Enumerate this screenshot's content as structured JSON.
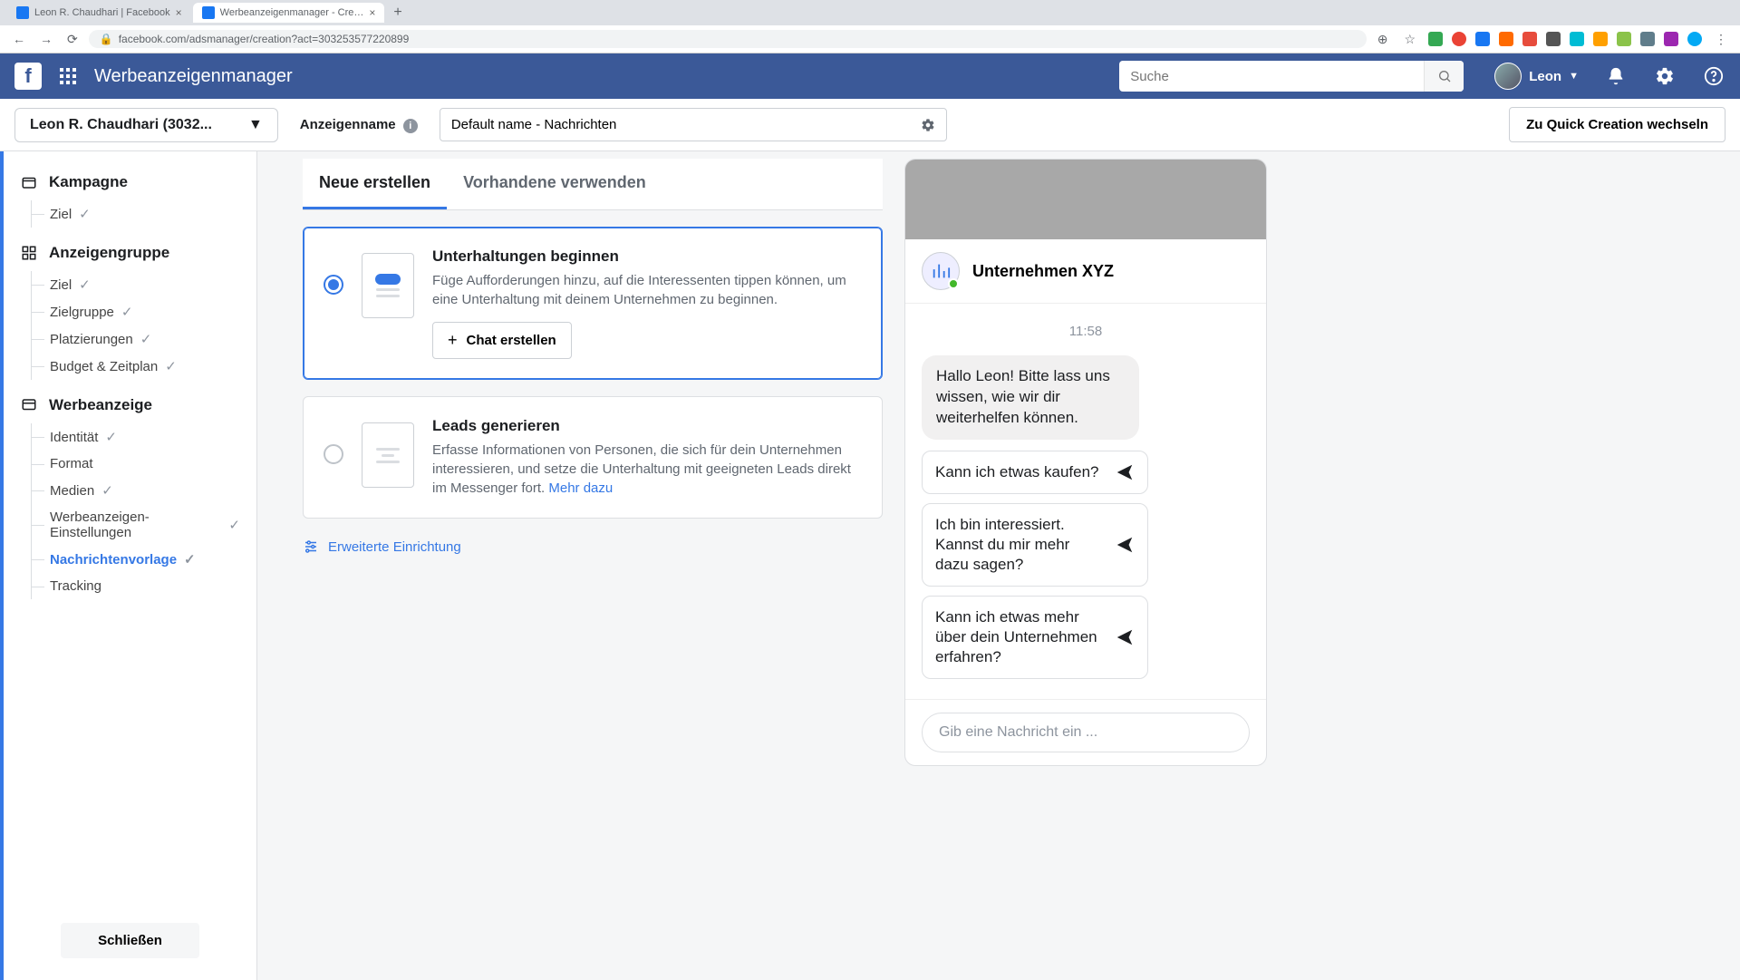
{
  "browser": {
    "tabs": [
      {
        "title": "Leon R. Chaudhari | Facebook",
        "active": false
      },
      {
        "title": "Werbeanzeigenmanager - Cre…",
        "active": true
      }
    ],
    "url": "facebook.com/adsmanager/creation?act=303253577220899"
  },
  "appbar": {
    "title": "Werbeanzeigenmanager",
    "search_placeholder": "Suche",
    "user_name": "Leon"
  },
  "secondbar": {
    "account": "Leon R. Chaudhari (3032...",
    "name_label": "Anzeigenname",
    "name_value": "Default name - Nachrichten",
    "quick_creation": "Zu Quick Creation wechseln"
  },
  "sidebar": {
    "groups": [
      {
        "title": "Kampagne",
        "items": [
          {
            "label": "Ziel",
            "checked": true
          }
        ]
      },
      {
        "title": "Anzeigengruppe",
        "items": [
          {
            "label": "Ziel",
            "checked": true
          },
          {
            "label": "Zielgruppe",
            "checked": true
          },
          {
            "label": "Platzierungen",
            "checked": true
          },
          {
            "label": "Budget & Zeitplan",
            "checked": true
          }
        ]
      },
      {
        "title": "Werbeanzeige",
        "items": [
          {
            "label": "Identität",
            "checked": true
          },
          {
            "label": "Format",
            "checked": false
          },
          {
            "label": "Medien",
            "checked": true
          },
          {
            "label": "Werbeanzeigen-Einstellungen",
            "checked": true
          },
          {
            "label": "Nachrichtenvorlage",
            "checked": true,
            "active": true
          },
          {
            "label": "Tracking",
            "checked": false
          }
        ]
      }
    ],
    "close": "Schließen"
  },
  "tabs": {
    "create": "Neue erstellen",
    "existing": "Vorhandene verwenden"
  },
  "cards": {
    "conv": {
      "title": "Unterhaltungen beginnen",
      "desc": "Füge Aufforderungen hinzu, auf die Interessenten tippen können, um eine Unterhaltung mit deinem Unternehmen zu beginnen.",
      "button": "Chat erstellen"
    },
    "leads": {
      "title": "Leads generieren",
      "desc": "Erfasse Informationen von Personen, die sich für dein Unternehmen interessieren, und setze die Unterhaltung mit geeigneten Leads direkt im Messenger fort. ",
      "more": "Mehr dazu"
    },
    "advanced": "Erweiterte Einrichtung"
  },
  "preview": {
    "business": "Unternehmen XYZ",
    "time": "11:58",
    "greeting": "Hallo Leon! Bitte lass uns wissen, wie wir dir weiterhelfen können.",
    "replies": [
      "Kann ich etwas kaufen?",
      "Ich bin interessiert. Kannst du mir mehr dazu sagen?",
      "Kann ich etwas mehr über dein Unternehmen erfahren?"
    ],
    "input_placeholder": "Gib eine Nachricht ein ..."
  }
}
